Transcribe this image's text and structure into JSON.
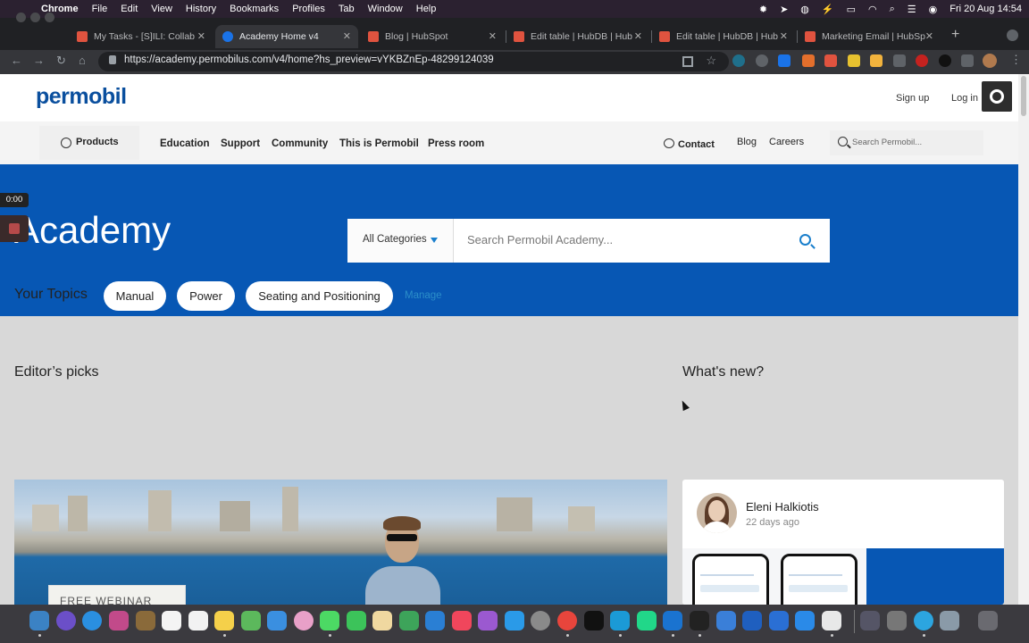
{
  "menubar": {
    "app": "Chrome",
    "items": [
      "File",
      "Edit",
      "View",
      "History",
      "Bookmarks",
      "Profiles",
      "Tab",
      "Window",
      "Help"
    ],
    "datetime": "Fri 20 Aug  14:54"
  },
  "tabs": [
    {
      "title": "My Tasks - [S]ILI: Collab",
      "fav_color": "#e0533f"
    },
    {
      "title": "Academy Home v4",
      "fav_color": "#1a73e8"
    },
    {
      "title": "Blog | HubSpot",
      "fav_color": "#e0533f"
    },
    {
      "title": "Edit table | HubDB | Hub",
      "fav_color": "#e0533f"
    },
    {
      "title": "Edit table | HubDB | Hub",
      "fav_color": "#e0533f"
    },
    {
      "title": "Marketing Email | HubSp",
      "fav_color": "#e0533f"
    }
  ],
  "address_bar": {
    "url": "https://academy.permobilus.com/v4/home?hs_preview=vYKBZnEp-48299124039"
  },
  "site": {
    "logo": "permobil",
    "signup": "Sign up",
    "login": "Log in",
    "nav": {
      "products": "Products",
      "links": [
        "Education",
        "Support",
        "Community",
        "This is Permobil",
        "Press room"
      ],
      "contact": "Contact",
      "blog": "Blog",
      "careers": "Careers",
      "search_placeholder": "Search Permobil..."
    },
    "hero": {
      "title": "Academy",
      "category_label": "All Categories",
      "search_placeholder": "Search Permobil Academy..."
    },
    "topics": {
      "label": "Your Topics",
      "items": [
        "Manual",
        "Power",
        "Seating and Positioning"
      ],
      "manage": "Manage"
    },
    "editors_picks": {
      "title": "Editor’s picks",
      "image_banner": "FREE WEBINAR"
    },
    "whats_new": {
      "title": "What's new?",
      "author": "Eleni Halkiotis",
      "age": "22 days ago"
    }
  },
  "recorder": {
    "timer": "0:00"
  },
  "colors": {
    "brand_blue": "#0757b4",
    "link_blue": "#2b8ec9",
    "logo_blue": "#0a4f9e"
  }
}
